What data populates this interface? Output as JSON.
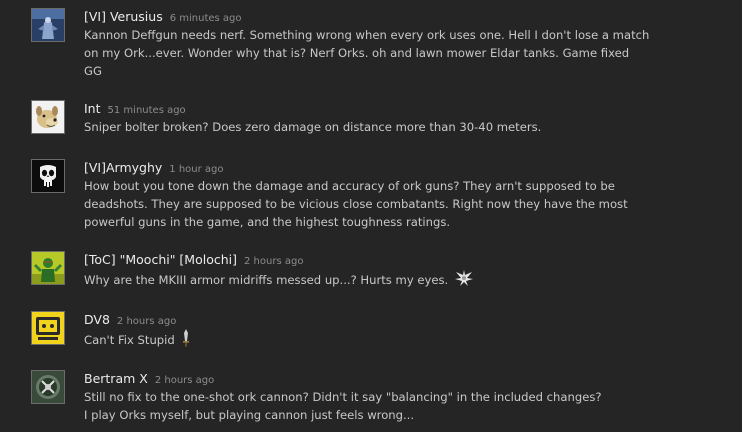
{
  "comments": [
    {
      "author": "[VI] Verusius",
      "time": "6 minutes ago",
      "lines": [
        "Kannon Deffgun needs nerf. Something wrong when every ork uses one. Hell I don't lose a match",
        "on my Ork...ever. Wonder why that is? Nerf Orks. oh and lawn mower Eldar tanks. Game fixed",
        "GG"
      ],
      "avatar": "blue-armored-figure-avatar"
    },
    {
      "author": "Int",
      "time": "51 minutes ago",
      "lines": [
        "Sniper bolter broken? Does zero damage on distance more than 30-40 meters."
      ],
      "avatar": "cartoon-dog-avatar"
    },
    {
      "author": "[VI]Armyghy",
      "time": "1 hour ago",
      "lines": [
        "How bout you tone down the damage and accuracy of ork guns? They arn't supposed to be",
        "deadshots. They are supposed to be vicious close combatants. Right now they have the most",
        "powerful guns in the game, and the highest toughness ratings."
      ],
      "avatar": "punisher-skull-avatar"
    },
    {
      "author": "[ToC] \"Moochi\" [Molochi]",
      "time": "2 hours ago",
      "lines": [
        "Why are the MKIII armor midriffs messed up...? Hurts my eyes."
      ],
      "avatar": "green-ork-avatar",
      "emote": "winged-emblem-icon"
    },
    {
      "author": "DV8",
      "time": "2 hours ago",
      "lines": [
        "Can't Fix Stupid"
      ],
      "avatar": "yellow-badge-avatar",
      "emote": "sword-icon"
    },
    {
      "author": "Bertram X",
      "time": "2 hours ago",
      "lines": [
        "Still no fix to the one-shot ork cannon? Didn't it say \"balancing\" in the included changes?",
        "I play Orks myself, but playing cannon just feels wrong..."
      ],
      "avatar": "emblem-badge-avatar"
    }
  ],
  "colors": {
    "background": "#252525",
    "author": "#ebebeb",
    "time": "#8c8c8c",
    "body": "#c8c8c8"
  }
}
